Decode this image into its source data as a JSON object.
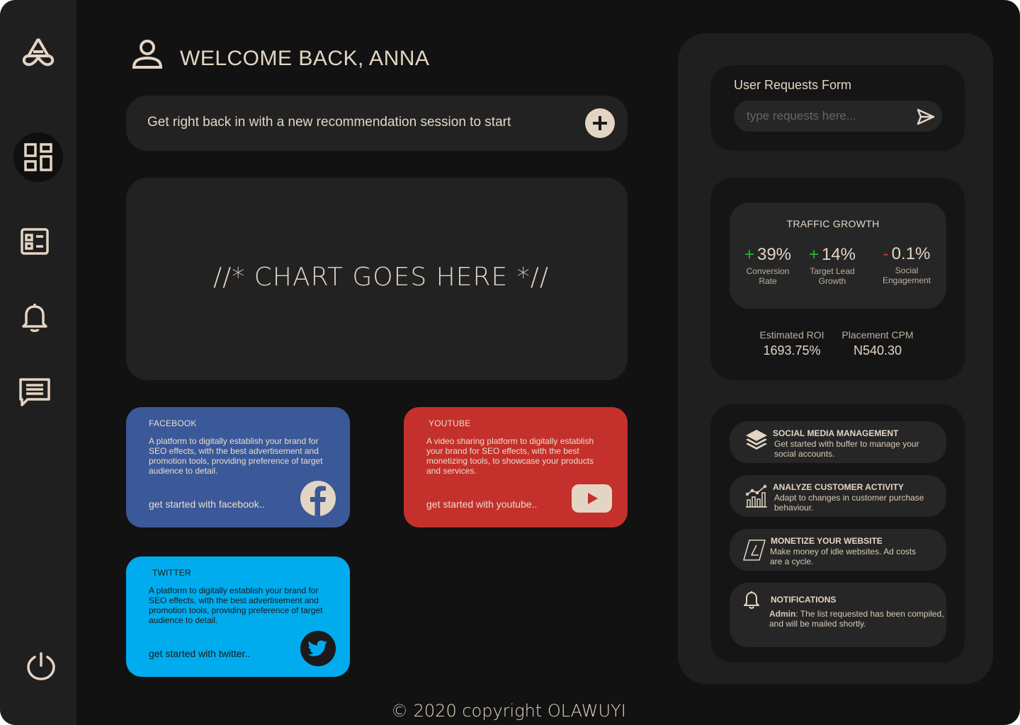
{
  "header": {
    "welcome": "WELCOME BACK, ANNA"
  },
  "session": {
    "text": "Get right back in with a new recommendation session to start"
  },
  "chart_placeholder": "//* CHART GOES HERE *//",
  "cards": {
    "facebook": {
      "title": "FACEBOOK",
      "desc": "A platform to digitally establish your brand for SEO effects, with the best  advertisement  and promotion tools, providing preference of target audience to detail.",
      "link": "get started with facebook.."
    },
    "youtube": {
      "title": "YOUTUBE",
      "desc": "A video sharing platform to digitally establish your brand for SEO effects, with the best monetizing tools, to showcase your products and services.",
      "link": "get started with youtube.."
    },
    "twitter": {
      "title": "TWITTER",
      "desc": "A platform to digitally establish your brand for SEO effects, with the best  advertisement  and promotion tools, providing preference of target audience to detail.",
      "link": "get started with twitter.."
    }
  },
  "footer": "© 2020 copyright OLAWUYI",
  "requests": {
    "title": "User Requests Form",
    "placeholder": "type requests here..."
  },
  "traffic": {
    "title": "TRAFFIC GROWTH",
    "stats": [
      {
        "sign": "+",
        "value": "39%",
        "label_line1": "Conversion",
        "label_line2": "Rate",
        "trend": "up"
      },
      {
        "sign": "+",
        "value": "14%",
        "label_line1": "Target Lead",
        "label_line2": "Growth",
        "trend": "up"
      },
      {
        "sign": "-",
        "value": "0.1%",
        "label_line1": "Social",
        "label_line2": "Engagement",
        "trend": "down"
      }
    ],
    "kpis": [
      {
        "label": "Estimated ROI",
        "value": "1693.75%"
      },
      {
        "label": "Placement CPM",
        "value": "N540.30"
      }
    ]
  },
  "features": [
    {
      "title": "SOCIAL MEDIA MANAGEMENT",
      "desc": "Get started with buffer to manage your social accounts.",
      "icon": "layers-icon"
    },
    {
      "title": "ANALYZE CUSTOMER ACTIVITY",
      "desc": "Adapt to changes in customer purchase behaviour.",
      "icon": "analytics-chart-icon"
    },
    {
      "title": "MONETIZE YOUR WEBSITE",
      "desc": "Make money of idle websites. Ad costs are a cycle.",
      "icon": "ad-page-icon"
    },
    {
      "title": "NOTIFICATIONS",
      "desc_bold": "Admin",
      "desc": ": The list requested has been compiled, and will be mailed shortly.",
      "icon": "bell-icon"
    }
  ],
  "colors": {
    "background": "#121212",
    "sidebar": "#1f1f1f",
    "accent": "#e3d5c3",
    "facebook": "#3b5998",
    "youtube": "#c4302b",
    "twitter": "#00acee",
    "positive": "#1fbf2b",
    "negative": "#d9362b"
  }
}
